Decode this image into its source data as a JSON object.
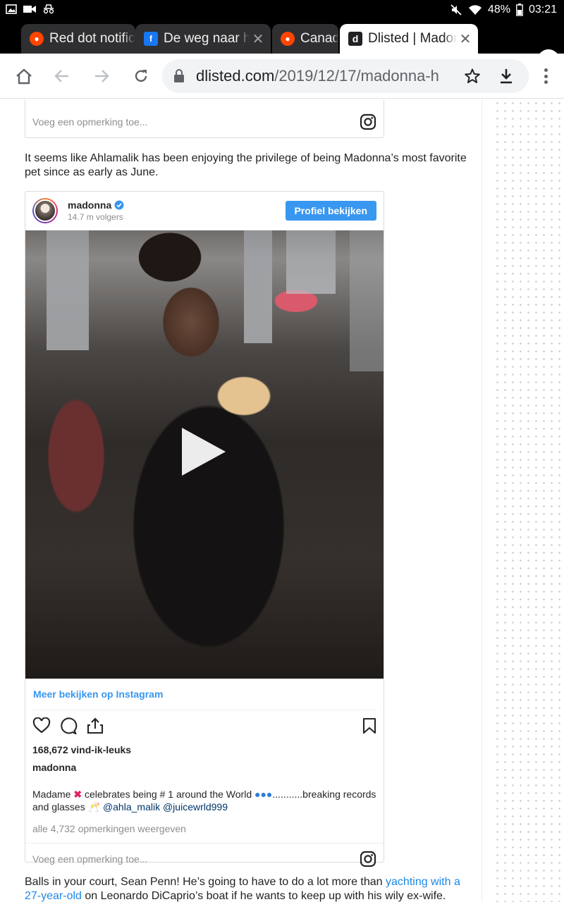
{
  "status_bar": {
    "battery": "48%",
    "time": "03:21"
  },
  "tabs": [
    {
      "title": "Red dot notific",
      "favicon": "reddit-icon",
      "color": "#ff4500",
      "active": false
    },
    {
      "title": "De weg naar het",
      "favicon": "facebook-icon",
      "color": "#1877f2",
      "active": false
    },
    {
      "title": "Canad",
      "favicon": "reddit-icon",
      "color": "#ff4500",
      "active": false
    },
    {
      "title": "Dlisted | Madonna",
      "favicon": "dlisted-icon",
      "color": "#202124",
      "active": true
    }
  ],
  "omnibox": {
    "domain": "dlisted.com",
    "path": "/2019/12/17/madonna-h"
  },
  "top_comment": {
    "placeholder": "Voeg een opmerking toe..."
  },
  "paragraph1": "It seems like Ahlamalik has been enjoying the privilege of being Madonna’s most favorite pet since as early as June.",
  "instagram": {
    "username": "madonna",
    "followers": "14.7 m volgers",
    "profile_button": "Profiel bekijken",
    "more_link": "Meer bekijken op Instagram",
    "likes": "168,672 vind-ik-leuks",
    "owner": "madonna",
    "caption_part1": "Madame",
    "caption_part2": "celebrates being # 1 around the World",
    "caption_part3": "...........breaking records and glasses",
    "mention1": "@ahla_malik",
    "mention2": "@juicewrld999",
    "all_comments": "alle 4,732 opmerkingen weergeven",
    "comment_placeholder": "Voeg een opmerking toe..."
  },
  "paragraph2": {
    "part1": "Balls in your court, Sean Penn! He’s going to have to do a lot more than ",
    "link": "yachting with a 27-year-old",
    "part2": " on Leonardo DiCaprio’s boat if he wants to keep up with his wily ex-wife."
  }
}
